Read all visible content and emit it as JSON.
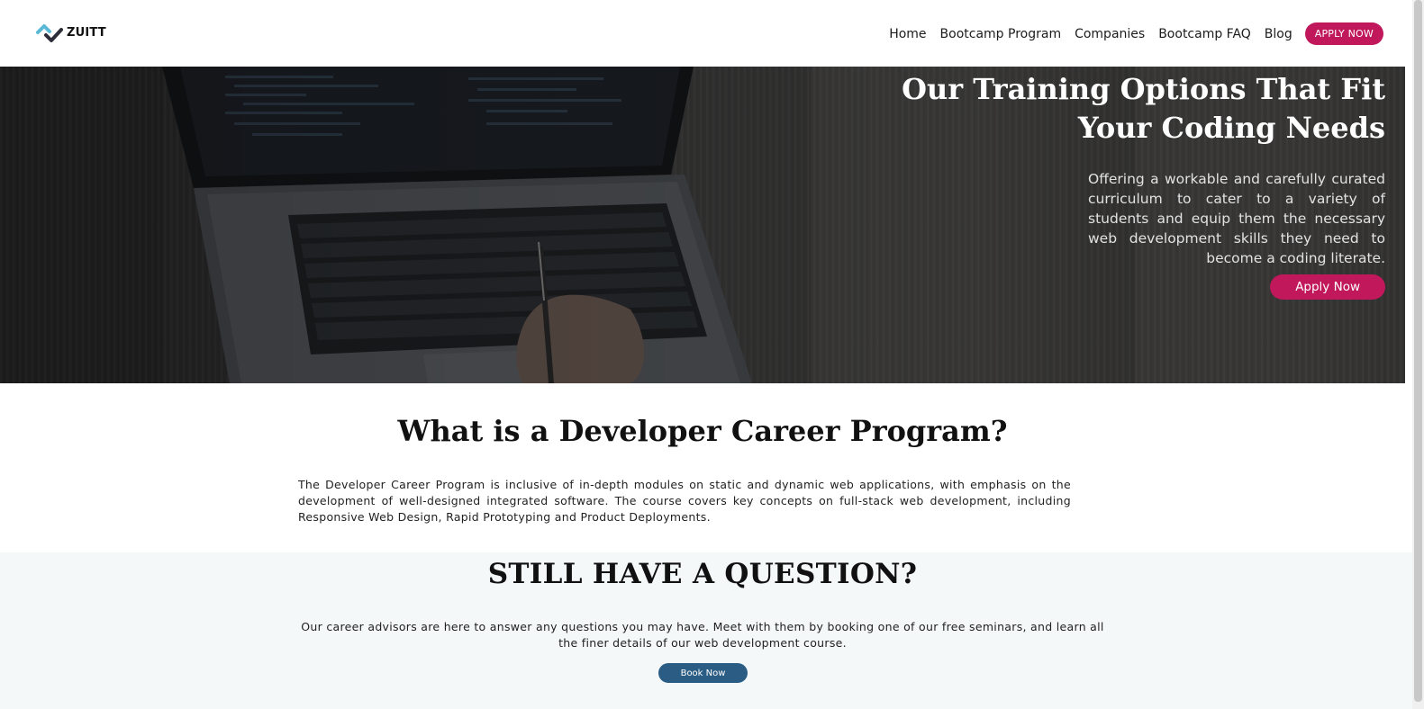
{
  "brand": {
    "name": "ZUITT",
    "accent_color": "#c0185b",
    "secondary_color": "#2b5c84",
    "logo_icon": "zuitt-check-icon"
  },
  "nav": {
    "items": [
      {
        "label": "Home"
      },
      {
        "label": "Bootcamp Program"
      },
      {
        "label": "Companies"
      },
      {
        "label": "Bootcamp FAQ"
      },
      {
        "label": "Blog"
      }
    ],
    "apply_label": "APPLY NOW"
  },
  "hero": {
    "title_line1": "Our Training Options That Fit",
    "title_line2": "Your Coding Needs",
    "subtitle": "Offering a workable and carefully curated curriculum to cater to a variety of students and equip them the necessary web development skills they need to become a coding literate.",
    "button_label": "Apply Now"
  },
  "program": {
    "title": "What is a Developer Career Program?",
    "text": "The Developer Career Program is inclusive of in-depth modules on static and dynamic web applications, with emphasis on the development of well-designed integrated software. The course covers key concepts on full-stack web development, including Responsive Web Design, Rapid Prototyping and Product Deployments."
  },
  "question": {
    "title": "STILL HAVE A QUESTION?",
    "text": "Our career advisors are here to answer any questions you may have. Meet with them by booking one of our free seminars, and learn all the finer details of our web development course.",
    "button_label": "Book Now"
  }
}
